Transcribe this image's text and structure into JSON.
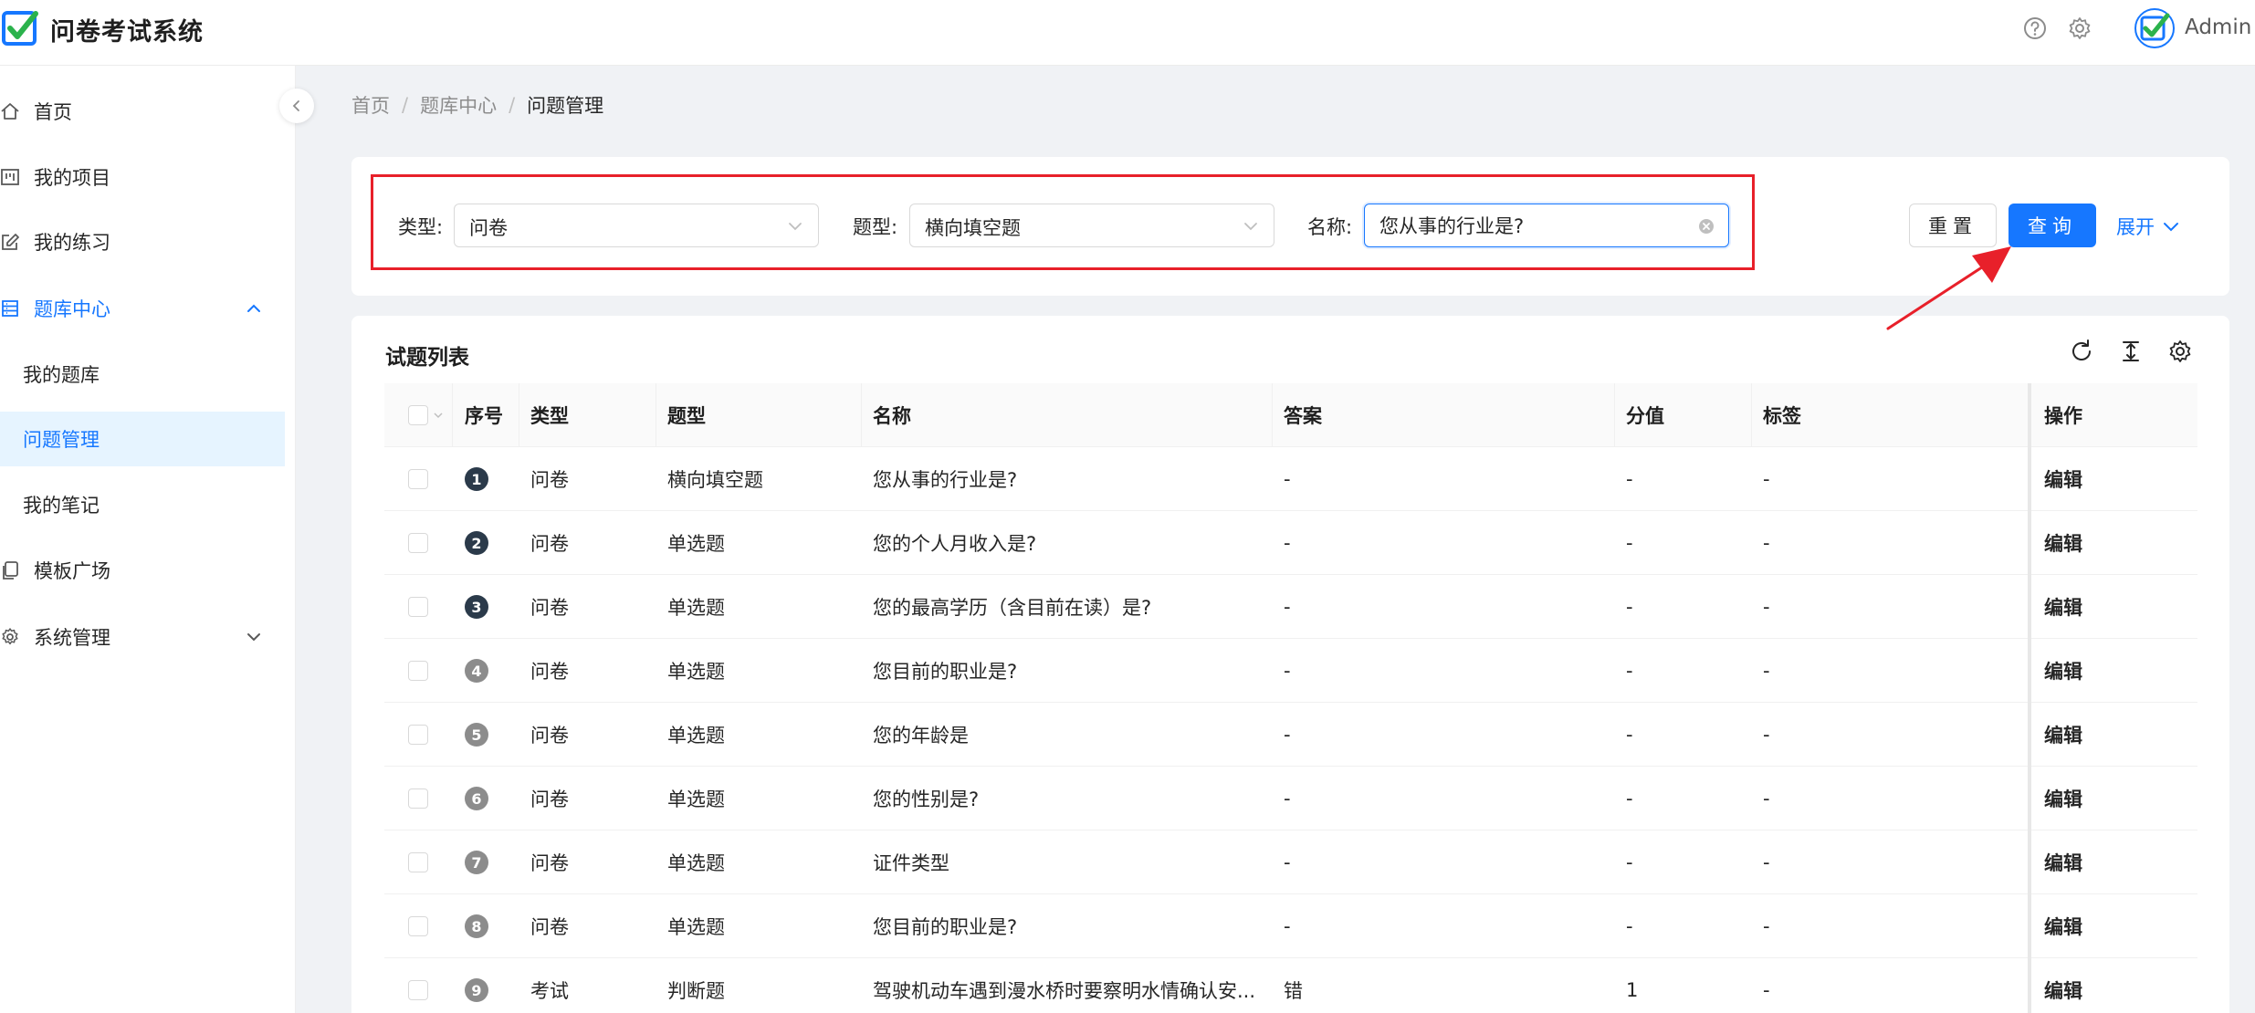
{
  "header": {
    "app_title": "问卷考试系统",
    "user_name": "Admin",
    "icons": [
      "question-circle-icon",
      "gear-icon",
      "avatar-check-icon"
    ]
  },
  "sidebar": {
    "items": [
      {
        "label": "首页",
        "icon": "home-icon"
      },
      {
        "label": "我的项目",
        "icon": "project-icon"
      },
      {
        "label": "我的练习",
        "icon": "edit-icon"
      },
      {
        "label": "题库中心",
        "icon": "database-icon",
        "expanded": true
      },
      {
        "label": "模板广场",
        "icon": "copy-icon"
      },
      {
        "label": "系统管理",
        "icon": "setting-icon"
      }
    ],
    "sub_items": [
      {
        "label": "我的题库",
        "selected": false
      },
      {
        "label": "问题管理",
        "selected": true
      },
      {
        "label": "我的笔记",
        "selected": false
      }
    ]
  },
  "breadcrumb": [
    "首页",
    "题库中心",
    "问题管理"
  ],
  "filter": {
    "type_label": "类型:",
    "type_value": "问卷",
    "qtype_label": "题型:",
    "qtype_value": "横向填空题",
    "name_label": "名称:",
    "name_value": "您从事的行业是?",
    "reset_label": "重置",
    "query_label": "查询",
    "expand_label": "展开"
  },
  "table": {
    "title": "试题列表",
    "toolbar_icons": [
      "reload-icon",
      "column-height-icon",
      "setting-icon"
    ],
    "columns": [
      "序号",
      "类型",
      "题型",
      "名称",
      "答案",
      "分值",
      "标签",
      "操作"
    ],
    "rows": [
      {
        "index": "1",
        "type": "问卷",
        "qtype": "横向填空题",
        "name": "您从事的行业是?",
        "answer": "-",
        "score": "-",
        "tag": "-",
        "op": "编辑"
      },
      {
        "index": "2",
        "type": "问卷",
        "qtype": "单选题",
        "name": "您的个人月收入是?",
        "answer": "-",
        "score": "-",
        "tag": "-",
        "op": "编辑"
      },
      {
        "index": "3",
        "type": "问卷",
        "qtype": "单选题",
        "name": "您的最高学历（含目前在读）是?",
        "answer": "-",
        "score": "-",
        "tag": "-",
        "op": "编辑"
      },
      {
        "index": "4",
        "type": "问卷",
        "qtype": "单选题",
        "name": "您目前的职业是?",
        "answer": "-",
        "score": "-",
        "tag": "-",
        "op": "编辑"
      },
      {
        "index": "5",
        "type": "问卷",
        "qtype": "单选题",
        "name": "您的年龄是",
        "answer": "-",
        "score": "-",
        "tag": "-",
        "op": "编辑"
      },
      {
        "index": "6",
        "type": "问卷",
        "qtype": "单选题",
        "name": "您的性别是?",
        "answer": "-",
        "score": "-",
        "tag": "-",
        "op": "编辑"
      },
      {
        "index": "7",
        "type": "问卷",
        "qtype": "单选题",
        "name": "证件类型",
        "answer": "-",
        "score": "-",
        "tag": "-",
        "op": "编辑"
      },
      {
        "index": "8",
        "type": "问卷",
        "qtype": "单选题",
        "name": "您目前的职业是?",
        "answer": "-",
        "score": "-",
        "tag": "-",
        "op": "编辑"
      },
      {
        "index": "9",
        "type": "考试",
        "qtype": "判断题",
        "name": "驾驶机动车遇到漫水桥时要察明水情确认安...",
        "answer": "错",
        "score": "1",
        "tag": "-",
        "op": "编辑"
      }
    ]
  },
  "colors": {
    "primary": "#1677ff",
    "highlight_red": "#e8202a",
    "badge_dark": "#2b3a4a",
    "badge_gray": "#8c8c8c"
  }
}
